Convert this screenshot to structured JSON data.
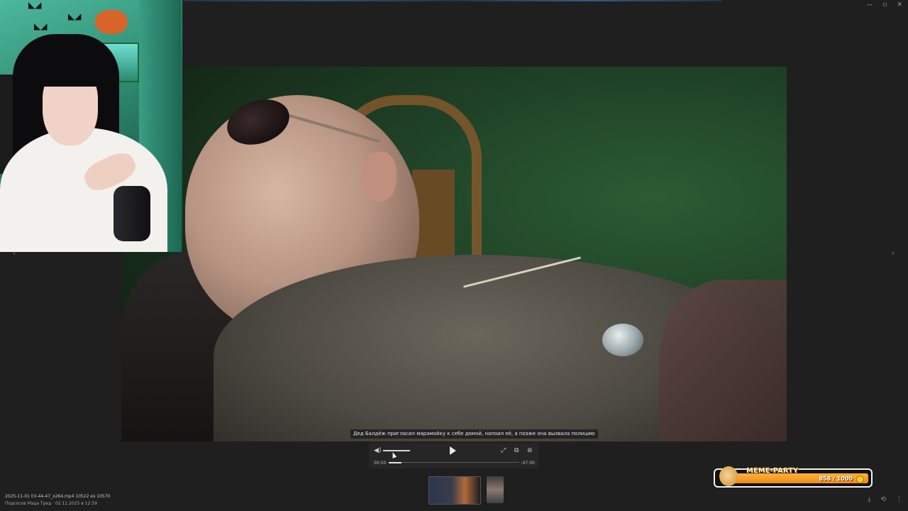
{
  "window": {
    "controls": [
      "—",
      "▫",
      "✕"
    ]
  },
  "subtitle": "Дед Балдёж пригласил марамойку к себе домой, напоил её, а позже она вызвала полицию",
  "player": {
    "current_time": "00:50",
    "total_time": "-07:00",
    "progress_fraction": 0.1,
    "volume_fraction": 0.9,
    "icons": [
      "volume-icon",
      "play-icon",
      "fullscreen-icon",
      "pip-icon",
      "speed-icon"
    ]
  },
  "file": {
    "name": "2025-11-01 03-44-47_x264.mp4 10522 из 10570",
    "meta": "Подсосов Мэда Тред · 02.11.2025 в 12:59"
  },
  "meme_party": {
    "title": "MEME-PARTY",
    "count": "858 / 1000"
  },
  "bottom_icons": [
    "download-icon",
    "rotate-icon",
    "more-icon"
  ],
  "nav": {
    "prev": "‹",
    "next": "›"
  }
}
